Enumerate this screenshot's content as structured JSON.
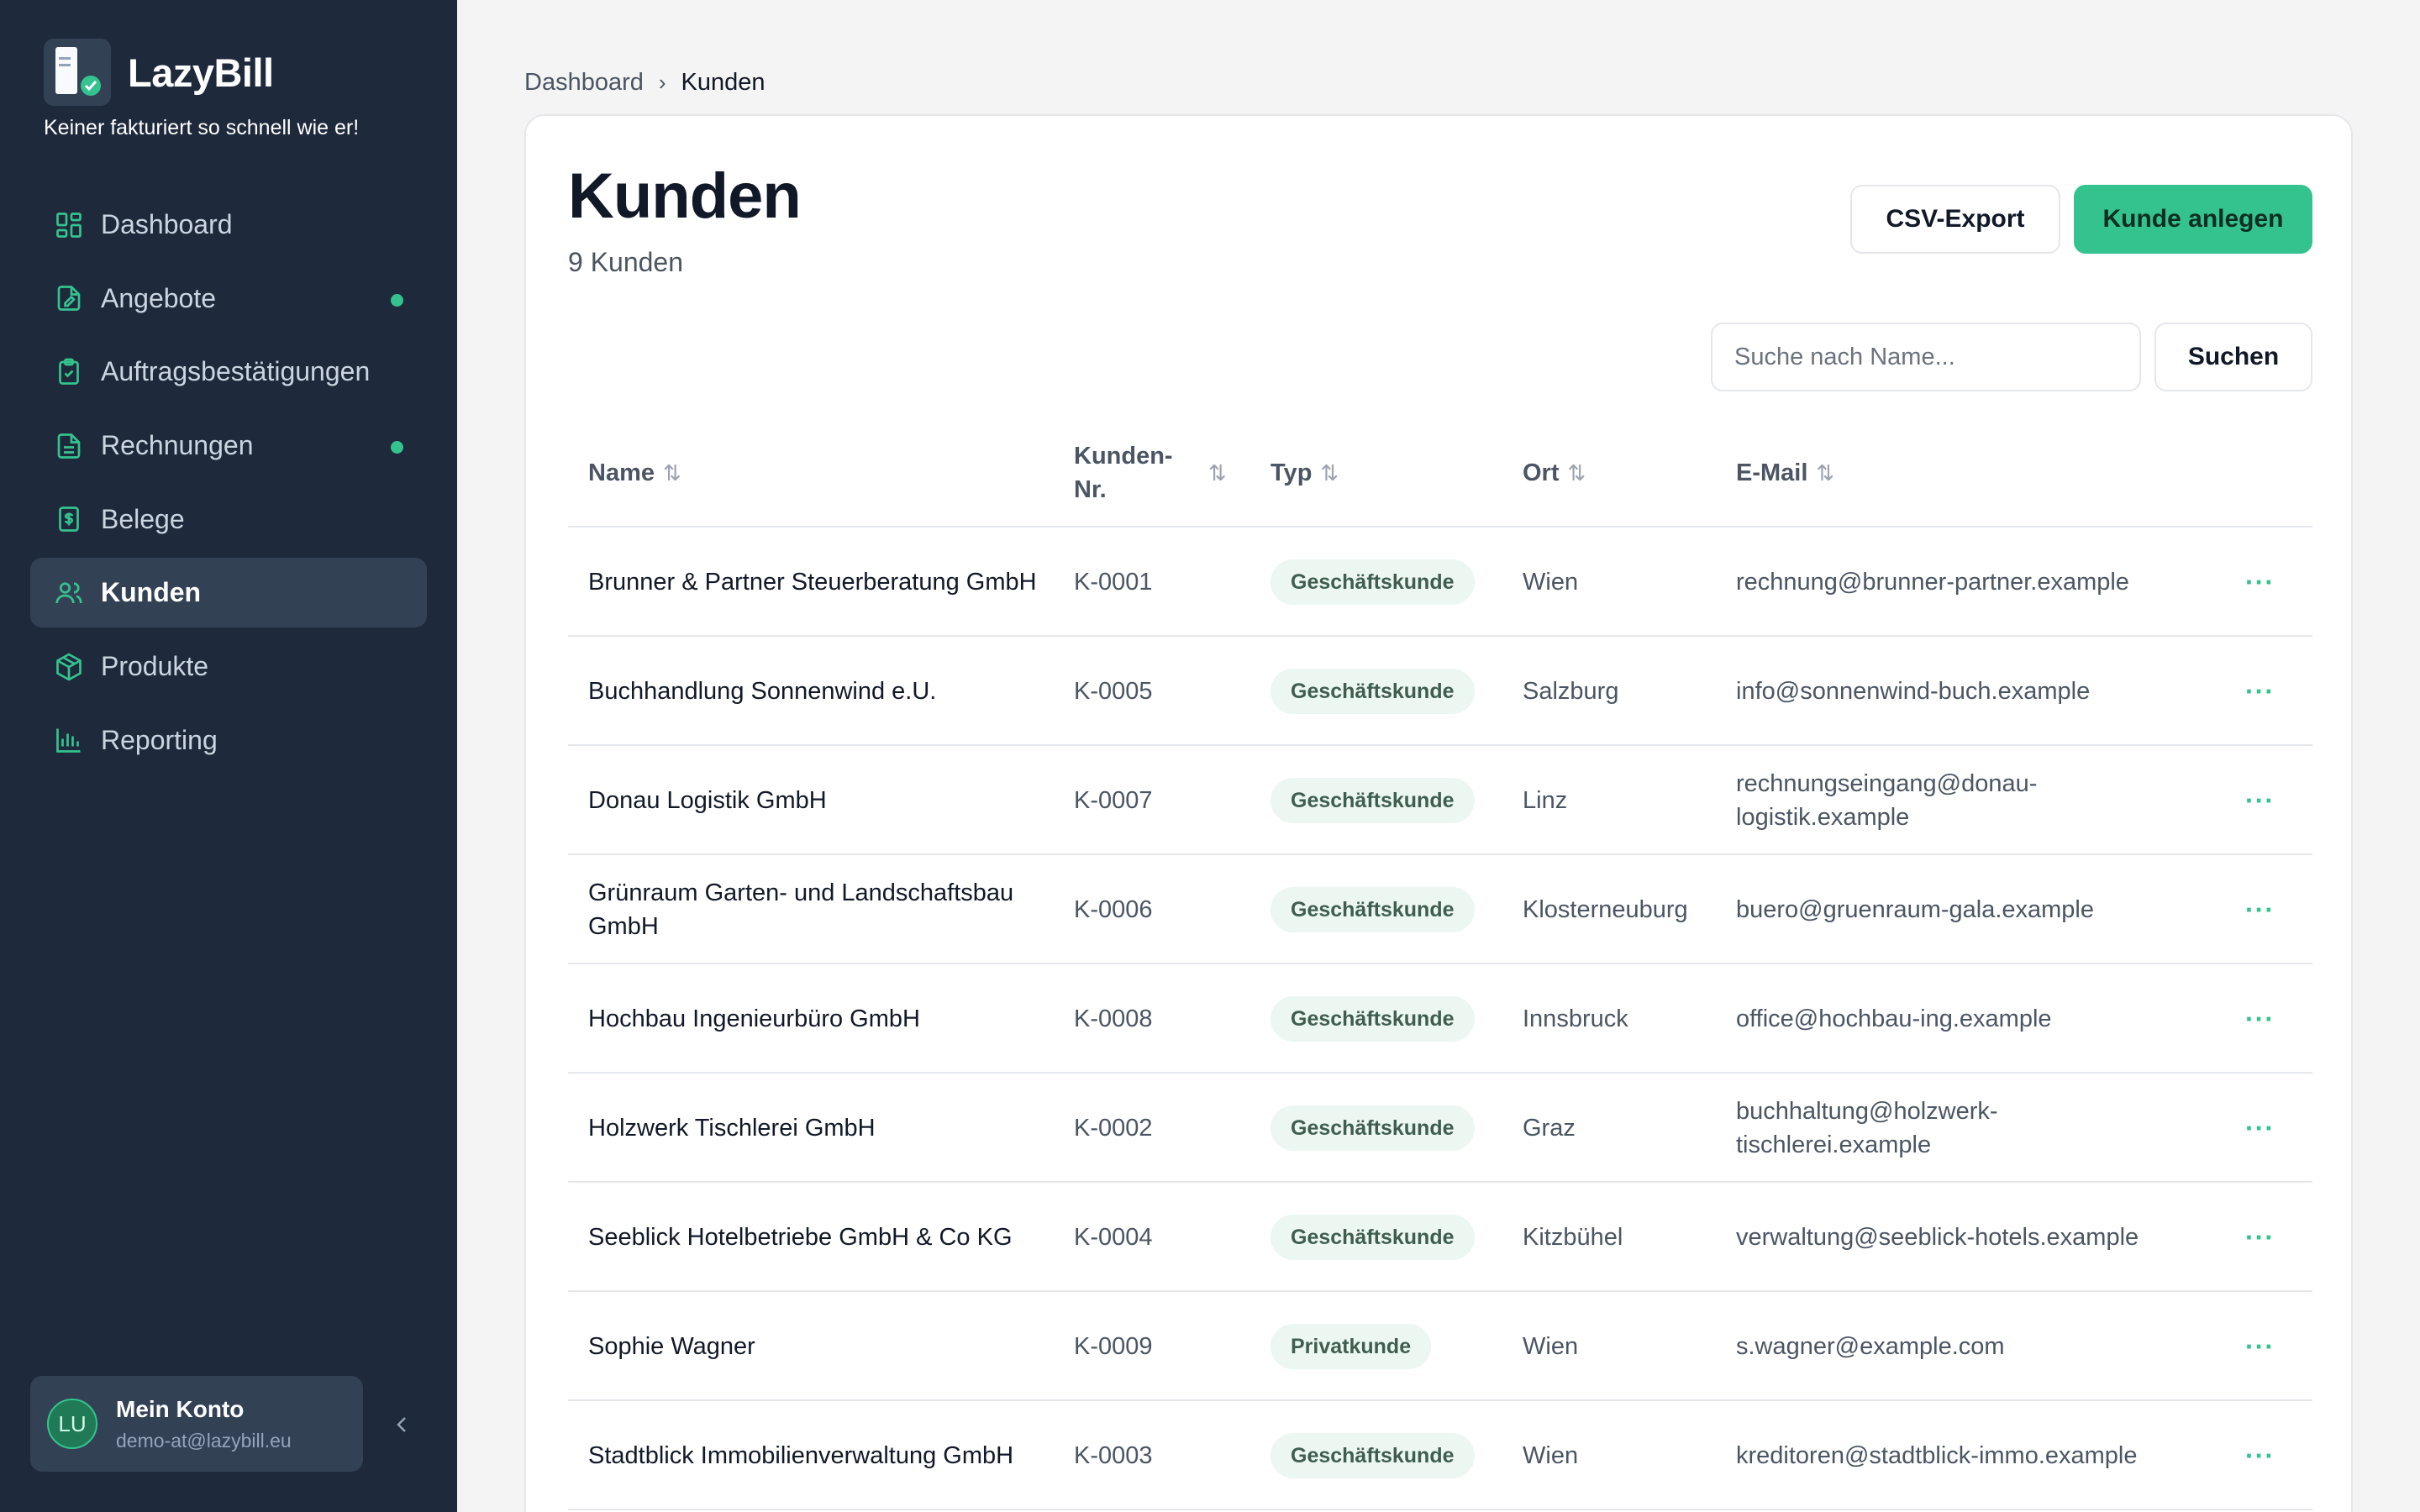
{
  "app": {
    "name": "LazyBill",
    "tagline": "Keiner fakturiert so schnell wie er!"
  },
  "sidebar": {
    "items": [
      {
        "label": "Dashboard",
        "icon": "dashboard-icon",
        "active": false,
        "dot": false
      },
      {
        "label": "Angebote",
        "icon": "file-edit-icon",
        "active": false,
        "dot": true
      },
      {
        "label": "Auftragsbestätigungen",
        "icon": "clipboard-check-icon",
        "active": false,
        "dot": false
      },
      {
        "label": "Rechnungen",
        "icon": "invoice-icon",
        "active": false,
        "dot": true
      },
      {
        "label": "Belege",
        "icon": "receipt-icon",
        "active": false,
        "dot": false
      },
      {
        "label": "Kunden",
        "icon": "users-icon",
        "active": true,
        "dot": false
      },
      {
        "label": "Produkte",
        "icon": "box-icon",
        "active": false,
        "dot": false
      },
      {
        "label": "Reporting",
        "icon": "bar-chart-icon",
        "active": false,
        "dot": false
      }
    ],
    "account": {
      "initials": "LU",
      "name": "Mein Konto",
      "email": "demo-at@lazybill.eu"
    }
  },
  "breadcrumb": {
    "parent": "Dashboard",
    "current": "Kunden"
  },
  "page": {
    "title": "Kunden",
    "subtitle": "9 Kunden",
    "export_label": "CSV-Export",
    "create_label": "Kunde anlegen",
    "search_placeholder": "Suche nach Name...",
    "search_button": "Suchen"
  },
  "colors": {
    "sidebar_bg": "#1e293b",
    "accent": "#34c38f",
    "badge_bg": "#ecf7f1"
  },
  "table": {
    "columns": [
      "Name",
      "Kunden-Nr.",
      "Typ",
      "Ort",
      "E-Mail"
    ],
    "rows": [
      {
        "name": "Brunner & Partner Steuerberatung GmbH",
        "nr": "K-0001",
        "typ": "Geschäftskunde",
        "ort": "Wien",
        "email": "rechnung@brunner-partner.example",
        "action": "···"
      },
      {
        "name": "Buchhandlung Sonnenwind e.U.",
        "nr": "K-0005",
        "typ": "Geschäftskunde",
        "ort": "Salzburg",
        "email": "info@sonnenwind-buch.example",
        "action": "···"
      },
      {
        "name": "Donau Logistik GmbH",
        "nr": "K-0007",
        "typ": "Geschäftskunde",
        "ort": "Linz",
        "email": "rechnungseingang@donau-logistik.example",
        "action": "···"
      },
      {
        "name": "Grünraum Garten- und Landschaftsbau GmbH",
        "nr": "K-0006",
        "typ": "Geschäftskunde",
        "ort": "Klosterneuburg",
        "email": "buero@gruenraum-gala.example",
        "action": "···"
      },
      {
        "name": "Hochbau Ingenieurbüro GmbH",
        "nr": "K-0008",
        "typ": "Geschäftskunde",
        "ort": "Innsbruck",
        "email": "office@hochbau-ing.example",
        "action": "···"
      },
      {
        "name": "Holzwerk Tischlerei GmbH",
        "nr": "K-0002",
        "typ": "Geschäftskunde",
        "ort": "Graz",
        "email": "buchhaltung@holzwerk-tischlerei.example",
        "action": "···"
      },
      {
        "name": "Seeblick Hotelbetriebe GmbH & Co KG",
        "nr": "K-0004",
        "typ": "Geschäftskunde",
        "ort": "Kitzbühel",
        "email": "verwaltung@seeblick-hotels.example",
        "action": "···"
      },
      {
        "name": "Sophie Wagner",
        "nr": "K-0009",
        "typ": "Privatkunde",
        "ort": "Wien",
        "email": "s.wagner@example.com",
        "action": "···"
      },
      {
        "name": "Stadtblick Immobilienverwaltung GmbH",
        "nr": "K-0003",
        "typ": "Geschäftskunde",
        "ort": "Wien",
        "email": "kreditoren@stadtblick-immo.example",
        "action": "···"
      }
    ]
  }
}
